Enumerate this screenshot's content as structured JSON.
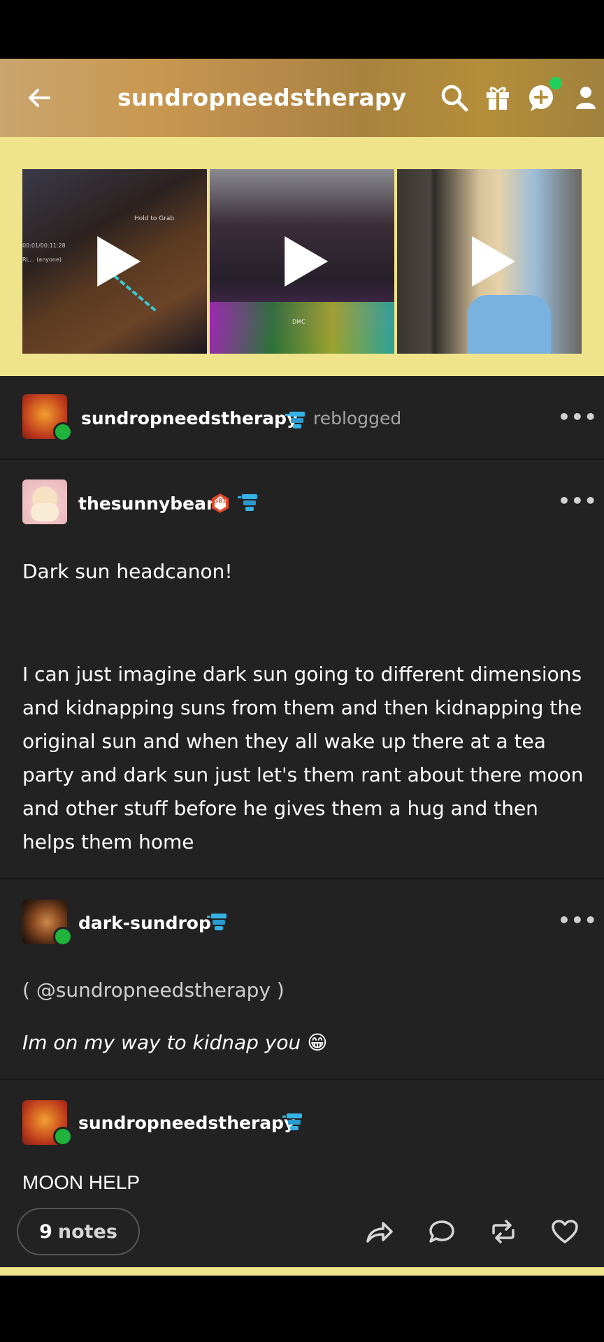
{
  "header": {
    "title": "sundropneedstherapy",
    "icons": [
      "arrow-left-icon",
      "search-icon",
      "gift-icon",
      "new-post-icon",
      "account-icon"
    ]
  },
  "banner": {
    "bg_color": "#efe38b",
    "thumb1_text": "Hold to Grab",
    "thumb1_side": "00:01/00:11:28\nRL... (anyone)",
    "thumb2_caption": "DMC"
  },
  "reblogger": {
    "name": "sundropneedstherapy",
    "action": "reblogged"
  },
  "trail": [
    {
      "name": "thesunnybear",
      "badge": "581",
      "paragraph1": "Dark sun headcanon!",
      "paragraph2": "I can just imagine dark sun going to different dimensions and kidnapping suns from them and then kidnapping the original sun and when they all wake up there at a tea party and dark sun just let's them rant about there moon and other stuff before he gives them a hug and then helps them home"
    },
    {
      "name": "dark-sundrop",
      "mention_open": "( ",
      "mention": "@sundropneedstherapy",
      "mention_close": " )",
      "text": "Im on my way to kidnap you 😁"
    },
    {
      "name": "sundropneedstherapy",
      "text": "MOON HELP"
    }
  ],
  "footer": {
    "notes_count": "9",
    "notes_label": "notes",
    "actions": [
      "share-icon",
      "reply-icon",
      "reblog-icon",
      "like-icon"
    ]
  },
  "colors": {
    "accent_yellow": "#efe38b",
    "post_bg": "#222222",
    "reblog_green": "#1fb33c"
  }
}
